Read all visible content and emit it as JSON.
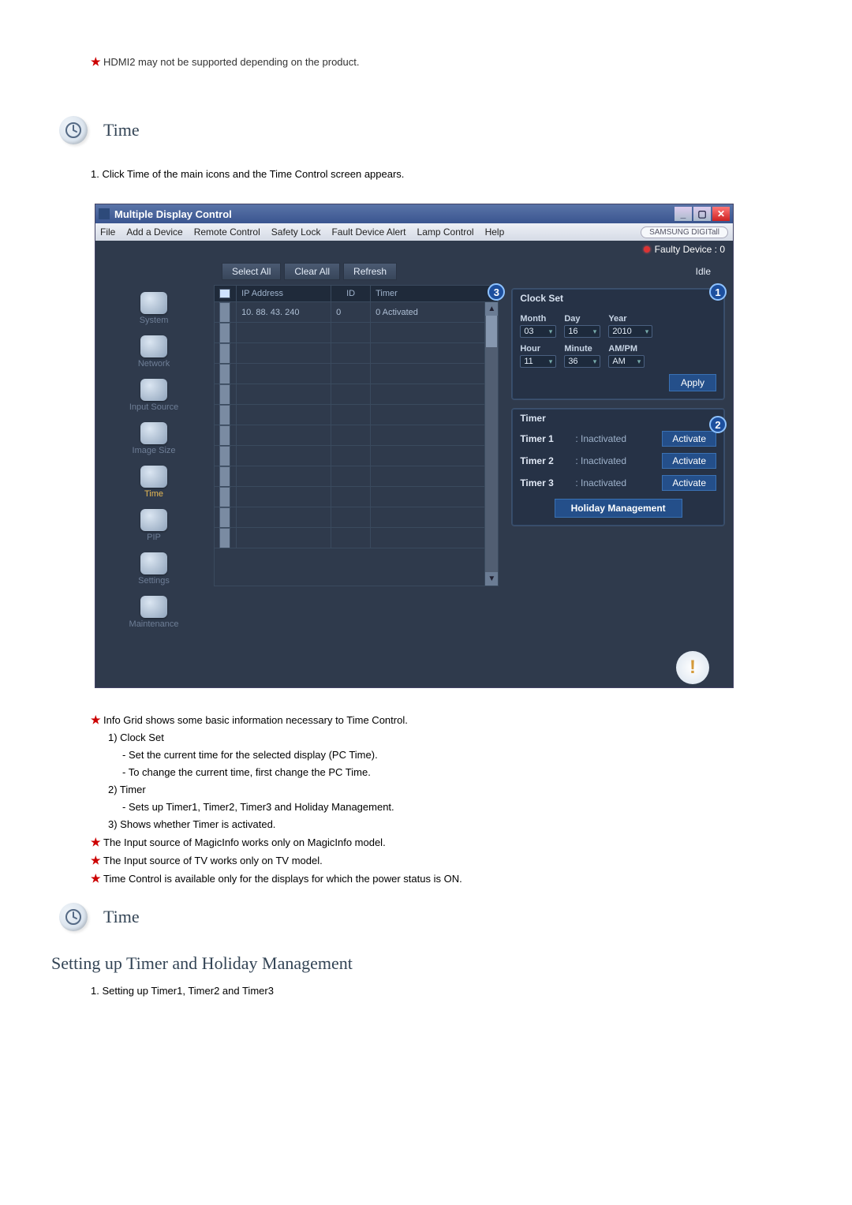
{
  "top_note": "HDMI2 may not be supported depending on the product.",
  "section1_title": "Time",
  "step1": "1. Click Time of the main icons and the Time Control screen appears.",
  "app": {
    "title": "Multiple Display Control",
    "menus": [
      "File",
      "Add a Device",
      "Remote Control",
      "Safety Lock",
      "Fault Device Alert",
      "Lamp Control",
      "Help"
    ],
    "brand": "SAMSUNG DIGITall",
    "faulty_label": "Faulty Device : 0",
    "buttons": {
      "select_all": "Select All",
      "clear_all": "Clear All",
      "refresh": "Refresh",
      "idle": "Idle"
    },
    "grid": {
      "headers": {
        "ip": "IP Address",
        "id": "ID",
        "timer": "Timer"
      },
      "row1": {
        "ip": "10. 88. 43. 240",
        "id": "0",
        "timer": "0 Activated"
      }
    },
    "sidebar": [
      "System",
      "Network",
      "Input Source",
      "Image Size",
      "Time",
      "PIP",
      "Settings",
      "Maintenance"
    ],
    "clock": {
      "title": "Clock Set",
      "labels": {
        "month": "Month",
        "day": "Day",
        "year": "Year",
        "hour": "Hour",
        "minute": "Minute",
        "ampm": "AM/PM"
      },
      "values": {
        "month": "03",
        "day": "16",
        "year": "2010",
        "hour": "11",
        "minute": "36",
        "ampm": "AM"
      },
      "apply": "Apply"
    },
    "timer": {
      "title": "Timer",
      "rows": [
        {
          "name": "Timer 1",
          "status": ": Inactivated",
          "btn": "Activate"
        },
        {
          "name": "Timer 2",
          "status": ": Inactivated",
          "btn": "Activate"
        },
        {
          "name": "Timer 3",
          "status": ": Inactivated",
          "btn": "Activate"
        }
      ],
      "holiday_btn": "Holiday Management"
    }
  },
  "desc": {
    "l1": "Info Grid shows some basic information necessary to Time Control.",
    "l2": "1) Clock Set",
    "l3": "- Set the current time for the selected display (PC Time).",
    "l4": "- To change the current time, first change the PC Time.",
    "l5": "2) Timer",
    "l6": "- Sets up Timer1, Timer2, Timer3 and Holiday Management.",
    "l7": "3) Shows whether Timer is activated.",
    "l8": "The Input source of MagicInfo works only on MagicInfo model.",
    "l9": "The Input source of TV works only on TV model.",
    "l10": "Time Control is available only for the displays for which the power status is ON."
  },
  "section2_title": "Time",
  "subheading": "Setting up Timer and Holiday Management",
  "step2": "1.  Setting up Timer1, Timer2 and Timer3"
}
